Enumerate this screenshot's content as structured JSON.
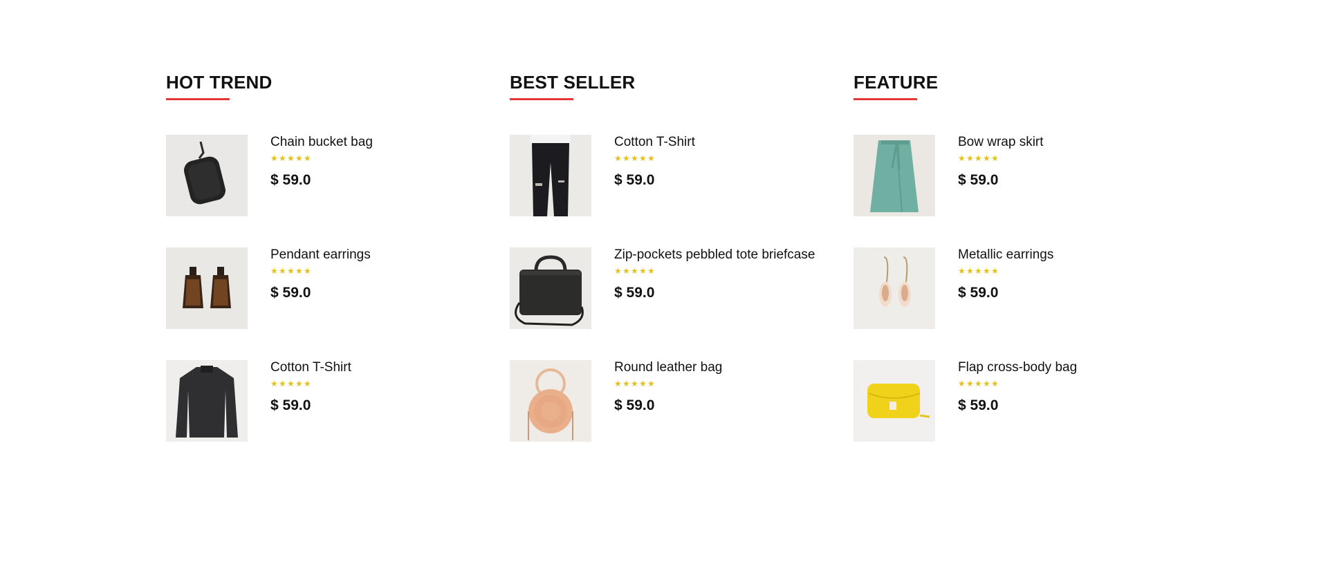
{
  "colors": {
    "accent": "#e53637",
    "star": "#e3c01c",
    "text": "#111111"
  },
  "sections": [
    {
      "title": "HOT TREND",
      "items": [
        {
          "name": "Chain bucket bag",
          "rating": 5,
          "price": "$ 59.0",
          "image": "black-pouch-bag"
        },
        {
          "name": "Pendant earrings",
          "rating": 5,
          "price": "$ 59.0",
          "image": "fringe-earrings"
        },
        {
          "name": "Cotton T-Shirt",
          "rating": 5,
          "price": "$ 59.0",
          "image": "dark-knit-top"
        }
      ]
    },
    {
      "title": "BEST SELLER",
      "items": [
        {
          "name": "Cotton T-Shirt",
          "rating": 5,
          "price": "$ 59.0",
          "image": "ripped-jeans"
        },
        {
          "name": "Zip-pockets pebbled tote briefcase",
          "rating": 5,
          "price": "$ 59.0",
          "image": "black-briefcase"
        },
        {
          "name": "Round leather bag",
          "rating": 5,
          "price": "$ 59.0",
          "image": "round-rattan-bag"
        }
      ]
    },
    {
      "title": "FEATURE",
      "items": [
        {
          "name": "Bow wrap skirt",
          "rating": 5,
          "price": "$ 59.0",
          "image": "green-wrap-skirt"
        },
        {
          "name": "Metallic earrings",
          "rating": 5,
          "price": "$ 59.0",
          "image": "shell-earrings"
        },
        {
          "name": "Flap cross-body bag",
          "rating": 5,
          "price": "$ 59.0",
          "image": "yellow-crossbody-bag"
        }
      ]
    }
  ]
}
